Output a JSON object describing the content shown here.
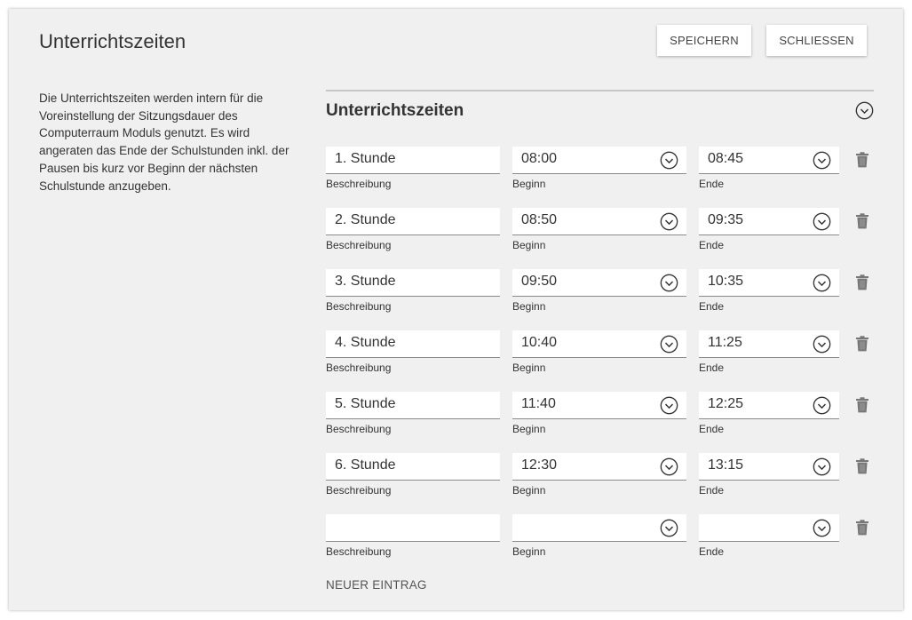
{
  "dialog": {
    "title": "Unterrichtszeiten",
    "save_label": "SPEICHERN",
    "close_label": "SCHLIESSEN",
    "description": "Die Unterrichtszeiten werden intern für die Voreinstellung der Sitzungsdauer des Computerraum Moduls genutzt. Es wird angeraten das Ende der Schulstunden inkl. der Pausen bis kurz vor Beginn der nächsten Schulstunde anzugeben."
  },
  "section": {
    "title": "Unterrichtszeiten",
    "labels": {
      "description": "Beschreibung",
      "begin": "Beginn",
      "end": "Ende"
    },
    "rows": [
      {
        "description": "1. Stunde",
        "begin": "08:00",
        "end": "08:45"
      },
      {
        "description": "2. Stunde",
        "begin": "08:50",
        "end": "09:35"
      },
      {
        "description": "3. Stunde",
        "begin": "09:50",
        "end": "10:35"
      },
      {
        "description": "4. Stunde",
        "begin": "10:40",
        "end": "11:25"
      },
      {
        "description": "5. Stunde",
        "begin": "11:40",
        "end": "12:25"
      },
      {
        "description": "6. Stunde",
        "begin": "12:30",
        "end": "13:15"
      },
      {
        "description": "",
        "begin": "",
        "end": ""
      }
    ],
    "add_label": "NEUER EINTRAG"
  },
  "icons": {
    "collapse": "chevron-up-circle-icon",
    "clock": "chevron-down-circle-icon",
    "delete": "trash-icon"
  },
  "colors": {
    "panel_bg": "#f0f0f0",
    "field_bg": "#ffffff",
    "icon": "#777777"
  }
}
